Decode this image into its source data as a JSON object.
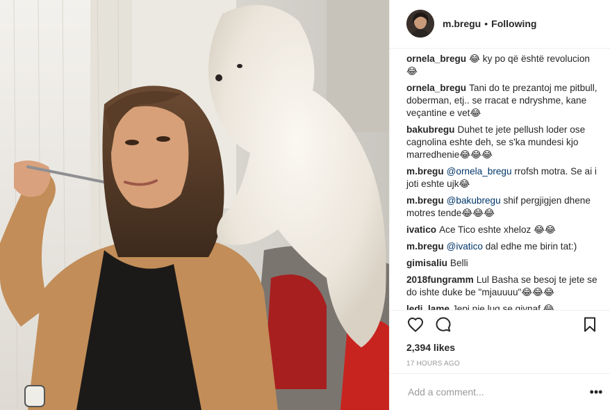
{
  "header": {
    "username": "m.bregu",
    "separator": "•",
    "follow_status": "Following"
  },
  "comments": [
    {
      "author": "ornela_bregu",
      "text": "😂 ky po që është revolucion 😂"
    },
    {
      "author": "ornela_bregu",
      "text": "Tani do te prezantoj me pitbull, doberman, etj.. se rracat e ndryshme, kane veçantine e vet😂"
    },
    {
      "author": "bakubregu",
      "text": "Duhet te jete pellush loder ose cagnolina eshte deh, se s'ka mundesi kjo marredhenie😂😂😂"
    },
    {
      "author": "m.bregu",
      "mention": "@ornela_bregu",
      "text": "rrofsh motra. Se ai i joti eshte ujk😂"
    },
    {
      "author": "m.bregu",
      "mention": "@bakubregu",
      "text": "shif pergjigjen dhene motres tende😂😂😂"
    },
    {
      "author": "ivatico",
      "text": "Ace Tico eshte xheloz 😂😂"
    },
    {
      "author": "m.bregu",
      "mention": "@ivatico",
      "text": "dal edhe me birin tat:)"
    },
    {
      "author": "gimisaliu",
      "text": "Belli"
    },
    {
      "author": "2018fungramm",
      "text": "Lul Basha se besoj te jete se do ishte duke be \"mjauuuu\"😂😂😂"
    },
    {
      "author": "ledi_lame",
      "text": "Jepi nje lug se gjynaf 😂"
    }
  ],
  "actions": {
    "like_icon": "heart-icon",
    "comment_icon": "comment-icon",
    "save_icon": "bookmark-icon"
  },
  "likes": "2,394 likes",
  "timestamp": "17 HOURS AGO",
  "add_comment": {
    "placeholder": "Add a comment...",
    "more_label": "•••"
  }
}
